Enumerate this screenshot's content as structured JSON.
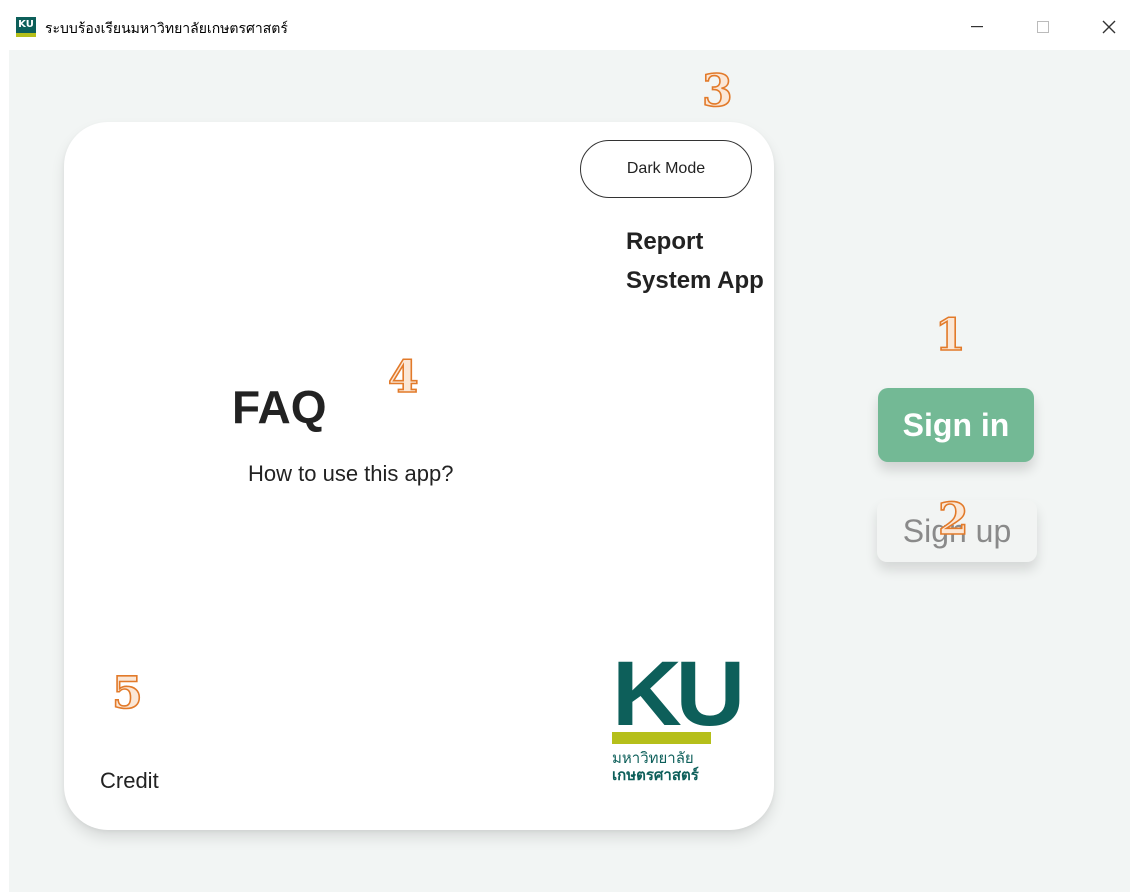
{
  "window": {
    "title": "ระบบร้องเรียนมหาวิทยาลัยเกษตรศาสตร์",
    "icon_label": "KU"
  },
  "card": {
    "dark_mode_label": "Dark Mode",
    "report_label": "Report System App",
    "faq_title": "FAQ",
    "faq_link": "How to use this app?",
    "credit_label": "Credit",
    "logo": {
      "letters": "KU",
      "thai_line_1": "มหาวิทยาลัย",
      "thai_line_2": "เกษตรศาสตร์"
    }
  },
  "auth": {
    "sign_in_label": "Sign in",
    "sign_up_label": "Sign up"
  },
  "annotations": [
    "1",
    "2",
    "3",
    "4",
    "5"
  ],
  "colors": {
    "background": "#f2f5f4",
    "card": "#ffffff",
    "sign_in": "#73b995",
    "ku_green": "#0d5f5a",
    "ku_yellow": "#b5bf1a",
    "annotation": "#e27a2a"
  }
}
